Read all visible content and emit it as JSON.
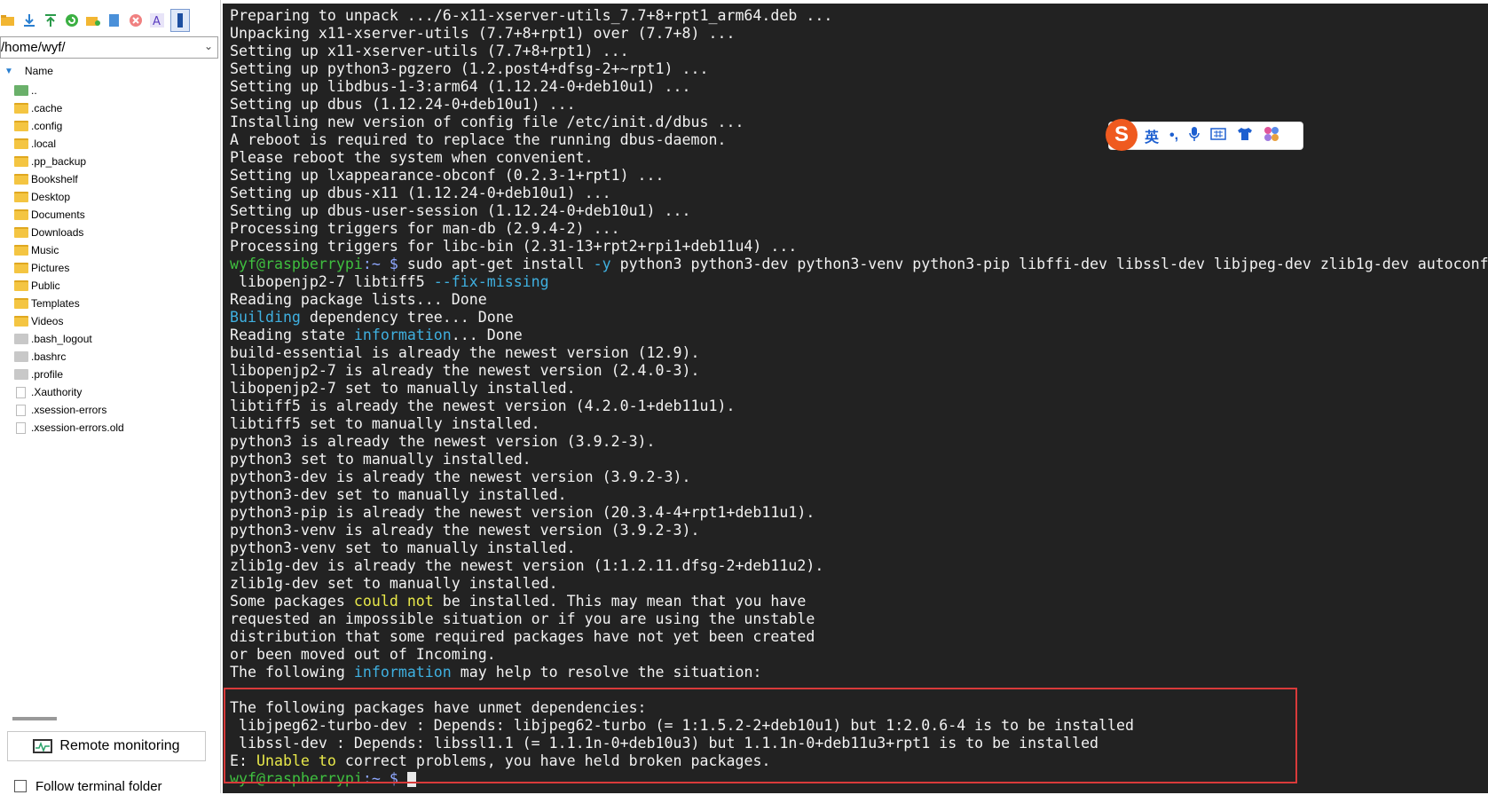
{
  "left_panel": {
    "path": "/home/wyf/",
    "column_header": "Name",
    "files": [
      {
        "name": "..",
        "type": "up"
      },
      {
        "name": ".cache",
        "type": "folder"
      },
      {
        "name": ".config",
        "type": "folder"
      },
      {
        "name": ".local",
        "type": "folder"
      },
      {
        "name": ".pp_backup",
        "type": "folder"
      },
      {
        "name": "Bookshelf",
        "type": "folder"
      },
      {
        "name": "Desktop",
        "type": "folder"
      },
      {
        "name": "Documents",
        "type": "folder"
      },
      {
        "name": "Downloads",
        "type": "folder"
      },
      {
        "name": "Music",
        "type": "folder"
      },
      {
        "name": "Pictures",
        "type": "folder"
      },
      {
        "name": "Public",
        "type": "folder"
      },
      {
        "name": "Templates",
        "type": "folder"
      },
      {
        "name": "Videos",
        "type": "folder"
      },
      {
        "name": ".bash_logout",
        "type": "gfile"
      },
      {
        "name": ".bashrc",
        "type": "gfile"
      },
      {
        "name": ".profile",
        "type": "gfile"
      },
      {
        "name": ".Xauthority",
        "type": "wfile"
      },
      {
        "name": ".xsession-errors",
        "type": "wfile"
      },
      {
        "name": ".xsession-errors.old",
        "type": "wfile"
      }
    ],
    "remote_monitoring_label": "Remote monitoring",
    "follow_terminal_label": "Follow terminal folder",
    "toolbar_icons": [
      "open-folder-icon",
      "download-icon",
      "upload-icon",
      "refresh-icon",
      "new-folder-icon",
      "new-file-icon",
      "delete-icon",
      "rename-icon",
      "terminal-icon"
    ]
  },
  "terminal": {
    "prompt_user": "wyf@raspberrypi",
    "prompt_path": ":~ $",
    "lines": [
      [
        {
          "t": "Preparing to unpack .../6-x11-xserver-utils_7.7+8+rpt1_arm64.deb ...",
          "c": ""
        }
      ],
      [
        {
          "t": "Unpacking x11-xserver-utils (7.7+8+rpt1) over (7.7+8) ...",
          "c": ""
        }
      ],
      [
        {
          "t": "Setting up x11-xserver-utils (7.7+8+rpt1) ...",
          "c": ""
        }
      ],
      [
        {
          "t": "Setting up python3-pgzero (1.2.post4+dfsg-2+~rpt1) ...",
          "c": ""
        }
      ],
      [
        {
          "t": "Setting up libdbus-1-3:arm64 (1.12.24-0+deb10u1) ...",
          "c": ""
        }
      ],
      [
        {
          "t": "Setting up dbus (1.12.24-0+deb10u1) ...",
          "c": ""
        }
      ],
      [
        {
          "t": "Installing new version of config file /etc/init.d/dbus ...",
          "c": ""
        }
      ],
      [
        {
          "t": "A reboot is required to replace the running dbus-daemon.",
          "c": ""
        }
      ],
      [
        {
          "t": "Please reboot the system when convenient.",
          "c": ""
        }
      ],
      [
        {
          "t": "Setting up lxappearance-obconf (0.2.3-1+rpt1) ...",
          "c": ""
        }
      ],
      [
        {
          "t": "Setting up dbus-x11 (1.12.24-0+deb10u1) ...",
          "c": ""
        }
      ],
      [
        {
          "t": "Setting up dbus-user-session (1.12.24-0+deb10u1) ...",
          "c": ""
        }
      ],
      [
        {
          "t": "Processing triggers for man-db (2.9.4-2) ...",
          "c": ""
        }
      ],
      [
        {
          "t": "Processing triggers for libc-bin (2.31-13+rpt2+rpi1+deb11u4) ...",
          "c": ""
        }
      ],
      [
        {
          "t": "wyf@raspberrypi",
          "c": "pg"
        },
        {
          "t": ":~ $ ",
          "c": "pb"
        },
        {
          "t": "sudo apt-get install ",
          "c": ""
        },
        {
          "t": "-y",
          "c": "cy"
        },
        {
          "t": " python3 python3-dev python3-venv python3-pip libffi-dev libssl-dev libjpeg-dev zlib1g-dev autoconf",
          "c": ""
        }
      ],
      [
        {
          "t": " libopenjp2-7 libtiff5 ",
          "c": ""
        },
        {
          "t": "--fix-missing",
          "c": "cy"
        }
      ],
      [
        {
          "t": "Reading package lists... Done",
          "c": ""
        }
      ],
      [
        {
          "t": "Building",
          "c": "cy"
        },
        {
          "t": " dependency tree... Done",
          "c": ""
        }
      ],
      [
        {
          "t": "Reading state ",
          "c": ""
        },
        {
          "t": "information",
          "c": "cy"
        },
        {
          "t": "... Done",
          "c": ""
        }
      ],
      [
        {
          "t": "build-essential is already the newest version (12.9).",
          "c": ""
        }
      ],
      [
        {
          "t": "libopenjp2-7 is already the newest version (2.4.0-3).",
          "c": ""
        }
      ],
      [
        {
          "t": "libopenjp2-7 set to manually installed.",
          "c": ""
        }
      ],
      [
        {
          "t": "libtiff5 is already the newest version (4.2.0-1+deb11u1).",
          "c": ""
        }
      ],
      [
        {
          "t": "libtiff5 set to manually installed.",
          "c": ""
        }
      ],
      [
        {
          "t": "python3 is already the newest version (3.9.2-3).",
          "c": ""
        }
      ],
      [
        {
          "t": "python3 set to manually installed.",
          "c": ""
        }
      ],
      [
        {
          "t": "python3-dev is already the newest version (3.9.2-3).",
          "c": ""
        }
      ],
      [
        {
          "t": "python3-dev set to manually installed.",
          "c": ""
        }
      ],
      [
        {
          "t": "python3-pip is already the newest version (20.3.4-4+rpt1+deb11u1).",
          "c": ""
        }
      ],
      [
        {
          "t": "python3-venv is already the newest version (3.9.2-3).",
          "c": ""
        }
      ],
      [
        {
          "t": "python3-venv set to manually installed.",
          "c": ""
        }
      ],
      [
        {
          "t": "zlib1g-dev is already the newest version (1:1.2.11.dfsg-2+deb11u2).",
          "c": ""
        }
      ],
      [
        {
          "t": "zlib1g-dev set to manually installed.",
          "c": ""
        }
      ],
      [
        {
          "t": "Some packages ",
          "c": ""
        },
        {
          "t": "could not",
          "c": "yl"
        },
        {
          "t": " be installed. This may mean that you have",
          "c": ""
        }
      ],
      [
        {
          "t": "requested an impossible situation or if you are using the unstable",
          "c": ""
        }
      ],
      [
        {
          "t": "distribution that some required packages have not yet been created",
          "c": ""
        }
      ],
      [
        {
          "t": "or been moved out of Incoming.",
          "c": ""
        }
      ],
      [
        {
          "t": "The following ",
          "c": ""
        },
        {
          "t": "information",
          "c": "cy"
        },
        {
          "t": " may help to resolve the situation:",
          "c": ""
        }
      ],
      [
        {
          "t": "",
          "c": ""
        }
      ],
      [
        {
          "t": "The following packages have unmet dependencies:",
          "c": ""
        }
      ],
      [
        {
          "t": " libjpeg62-turbo-dev : Depends: libjpeg62-turbo (= 1:1.5.2-2+deb10u1) but 1:2.0.6-4 is to be installed",
          "c": ""
        }
      ],
      [
        {
          "t": " libssl-dev : Depends: libssl1.1 (= 1.1.1n-0+deb10u3) but 1.1.1n-0+deb11u3+rpt1 is to be installed",
          "c": ""
        }
      ],
      [
        {
          "t": "E: ",
          "c": ""
        },
        {
          "t": "Unable to",
          "c": "yl"
        },
        {
          "t": " correct problems, you have held broken packages.",
          "c": ""
        }
      ],
      [
        {
          "t": "wyf@raspberrypi",
          "c": "pg"
        },
        {
          "t": ":~ $ ",
          "c": "pb"
        }
      ]
    ]
  },
  "ime": {
    "logo": "S",
    "mode": "英",
    "punct": "•,",
    "icons": [
      "mic-icon",
      "keyboard-icon",
      "skin-icon",
      "apps-icon"
    ]
  }
}
